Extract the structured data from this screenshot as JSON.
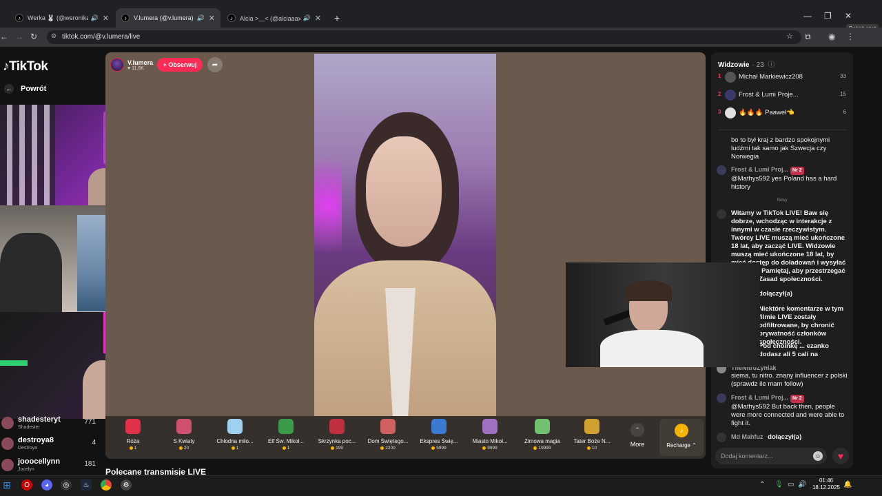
{
  "browser": {
    "tabs": [
      {
        "title": "Werka 🐰 (@weronikadoro",
        "active": false
      },
      {
        "title": "V.lumera (@v.lumera) prow",
        "active": true
      },
      {
        "title": "Alcia >﹏< (@alciaaaxo) pro",
        "active": false
      }
    ],
    "url": "tiktok.com/@v.lumera/live",
    "tooltip": "Pokaż czat"
  },
  "tiktok": {
    "logo": "TikTok",
    "back_label": "Powrót",
    "host_name": "V.lumera",
    "host_likes": "11.6K",
    "follow_label": "+ Obserwuj",
    "recommended_label": "Polecane transmisje LIVE"
  },
  "left_viewers": [
    {
      "name": "shadesteryt",
      "sub": "Shadester",
      "count": "771"
    },
    {
      "name": "destroya8",
      "sub": "Destroya",
      "count": "4"
    },
    {
      "name": "jooocellynn",
      "sub": "Jocelyn",
      "count": "181"
    }
  ],
  "gifts": [
    {
      "name": "Róża",
      "price": "1",
      "color": "#e0304a"
    },
    {
      "name": "S Kwiaty",
      "price": "20",
      "color": "#d05070"
    },
    {
      "name": "Chłodna miło...",
      "price": "1",
      "color": "#9fd0f0"
    },
    {
      "name": "Elf Św. Mikoł...",
      "price": "1",
      "color": "#3a9a4a"
    },
    {
      "name": "Skrzynka poc...",
      "price": "199",
      "color": "#c03040"
    },
    {
      "name": "Dom Świętego...",
      "price": "2200",
      "color": "#d06060"
    },
    {
      "name": "Ekspres Świę...",
      "price": "5999",
      "color": "#3a7ad0"
    },
    {
      "name": "Miasto Mikoł...",
      "price": "9999",
      "color": "#a070c0"
    },
    {
      "name": "Zimowa magia",
      "price": "19999",
      "color": "#70c070"
    },
    {
      "name": "Tater Boże N...",
      "price": "10",
      "color": "#d0a030"
    }
  ],
  "more_label": "More",
  "recharge_label": "Recharge",
  "chat": {
    "title": "Widzowie",
    "viewer_count": "· 23",
    "top_viewers": [
      {
        "rank": "1",
        "name": "Michał Markiewicz208",
        "score": "33"
      },
      {
        "rank": "2",
        "name": "Frost & Lumi Proje...",
        "score": "15"
      },
      {
        "rank": "3",
        "name": "🔥🔥🔥 Paaweł👈",
        "score": "6"
      }
    ],
    "messages": [
      {
        "name": "",
        "text": "bo to był kraj z bardzo spokojnymi ludźmi tak samo jak Szwecja czy Norwegia"
      },
      {
        "name": "Frost & Lumi Proj...",
        "badge": "Nr 2",
        "text": "@Mathys592 yes Poland has a hard history"
      },
      {
        "name": "",
        "text": "Witamy w TikTok LIVE! Baw się dobrze, wchodząc w interakcje z innymi w czasie rzeczywistym. Twórcy LIVE muszą mieć ukończone 18 lat, aby zacząć LIVE. Widzowie muszą mieć ukończone 18 lat, by mieć dostęp do doładowań i wysyłać Prezenty. Pamiętaj, aby przestrzegać naszych Zasad społeczności."
      },
      {
        "name": "",
        "text": "dołączył(a)"
      },
      {
        "name": "",
        "text": "Niektóre komentarze w tym filmie LIVE zostały odfiltrowane, by chronić prywatność członków społeczności."
      },
      {
        "name": "",
        "text": "Pod choinkę ... ezanko dodasz ali 5 cali na"
      },
      {
        "name": "TheNitroZyniak",
        "text": "siema, tu nitro. znany influencer z polski (sprawdz ile mam follow)"
      },
      {
        "name": "Frost & Lumi Proj...",
        "badge": "Nr 2",
        "text": "@Mathys592 But back then, people were more connected and were able to fight it."
      },
      {
        "name": "Md Mahfuz",
        "text": "dołączył(a)"
      }
    ],
    "new_label": "Nowy",
    "input_placeholder": "Dodaj komentarz..."
  },
  "taskbar": {
    "time": "01:46",
    "date": "18.12.2025"
  }
}
